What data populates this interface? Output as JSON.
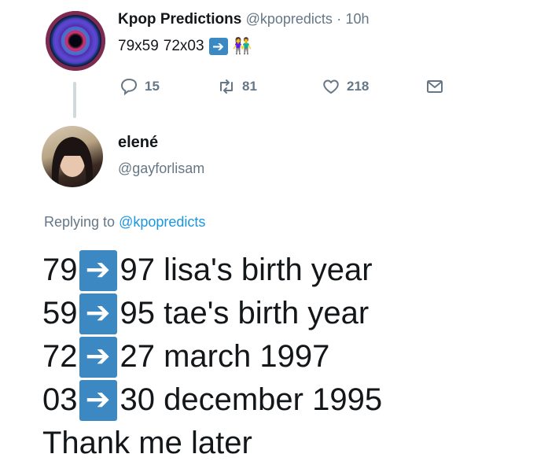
{
  "tweet1": {
    "author_name": "Kpop Predictions",
    "author_handle": "@kpopredicts",
    "separator": "·",
    "time": "10h",
    "text_a": "79x59",
    "text_b": "72x03",
    "arrow_icon": "right-arrow-emoji",
    "couple_icon": "couple-emoji",
    "replies": "15",
    "retweets": "81",
    "likes": "218"
  },
  "tweet2": {
    "author_name": "elené",
    "author_handle": "@gayforlisam",
    "replying_prefix": "Replying to",
    "replying_handle": "@kpopredicts",
    "lines": [
      {
        "left": "79",
        "right": "97 lisa's birth year"
      },
      {
        "left": "59",
        "right": "95 tae's birth year"
      },
      {
        "left": "72",
        "right": "27 march 1997"
      },
      {
        "left": "03",
        "right": "30 december 1995"
      }
    ],
    "closing": "Thank me later"
  },
  "colors": {
    "text": "#14171a",
    "muted": "#657786",
    "link": "#1b95e0",
    "arrow_bg": "#3b88c3"
  }
}
